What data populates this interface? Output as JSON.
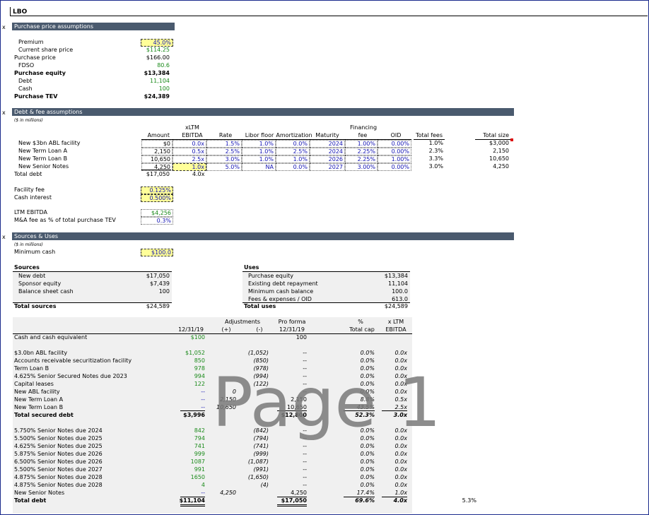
{
  "title": "LBO",
  "x_marker": "x",
  "sections": {
    "purchase": "Purchase price assumptions",
    "debt": "Debt & fee assumptions",
    "sources_uses": "Sources & Uses"
  },
  "units_note": "($ in millions)",
  "purchase": {
    "rows": [
      {
        "label": "Premium",
        "value": "45.0%"
      },
      {
        "label": "Current share price",
        "value": "$114.25"
      },
      {
        "label": "Purchase price",
        "value": "$166.00"
      },
      {
        "label": "FDSO",
        "value": "80.6"
      },
      {
        "label": "Purchase equity",
        "value": "$13,384"
      },
      {
        "label": "Debt",
        "value": "11,104"
      },
      {
        "label": "Cash",
        "value": "100"
      },
      {
        "label": "Purchase TEV",
        "value": "$24,389"
      }
    ]
  },
  "debt": {
    "headers": {
      "amount": "Amount",
      "xltm_top": "xLTM",
      "ebitda": "EBITDA",
      "rate": "Rate",
      "libor": "Libor floor",
      "amort": "Amortization",
      "maturity": "Maturity",
      "fin_top": "Financing",
      "fee": "fee",
      "oid": "OID",
      "total_fees": "Total fees",
      "total_size": "Total size"
    },
    "rows": [
      {
        "label": "New $3bn ABL facility",
        "amount": "$0",
        "ebitda": "0.0x",
        "rate": "1.5%",
        "libor": "1.0%",
        "amort": "0.0%",
        "maturity": "2024",
        "fee": "1.00%",
        "oid": "0.00%",
        "total_fees": "1.0%",
        "total_size": "$3,000"
      },
      {
        "label": "New Term Loan A",
        "amount": "2,150",
        "ebitda": "0.5x",
        "rate": "2.5%",
        "libor": "1.0%",
        "amort": "2.5%",
        "maturity": "2024",
        "fee": "2.25%",
        "oid": "0.00%",
        "total_fees": "2.3%",
        "total_size": "2,150"
      },
      {
        "label": "New Term Loan B",
        "amount": "10,650",
        "ebitda": "2.5x",
        "rate": "3.0%",
        "libor": "1.0%",
        "amort": "1.0%",
        "maturity": "2026",
        "fee": "2.25%",
        "oid": "1.00%",
        "total_fees": "3.3%",
        "total_size": "10,650"
      },
      {
        "label": "New Senior Notes",
        "amount": "4,250",
        "ebitda": "1.0x",
        "rate": "5.0%",
        "libor": "NA",
        "amort": "0.0%",
        "maturity": "2027",
        "fee": "3.00%",
        "oid": "0.00%",
        "total_fees": "3.0%",
        "total_size": "4,250"
      }
    ],
    "total": {
      "label": "Total debt",
      "amount": "$17,050",
      "ebitda": "4.0x"
    },
    "facility_fee_label": "Facility fee",
    "facility_fee": "0.125%",
    "cash_interest_label": "Cash interest",
    "cash_interest": "0.500%",
    "ltm_ebitda_label": "LTM EBITDA",
    "ltm_ebitda": "$4,256",
    "ma_fee_label": "M&A fee as % of total purchase TEV",
    "ma_fee": "0.3%"
  },
  "su": {
    "min_cash_label": "Minimum cash",
    "min_cash": "$100.0",
    "sources_title": "Sources",
    "sources": [
      {
        "label": "New debt",
        "value": "$17,050"
      },
      {
        "label": "Sponsor equity",
        "value": "$7,439"
      },
      {
        "label": "Balance sheet cash",
        "value": "100"
      }
    ],
    "total_sources_label": "Total sources",
    "total_sources": "$24,589",
    "uses_title": "Uses",
    "uses": [
      {
        "label": "Purchase equity",
        "value": "$13,384"
      },
      {
        "label": "Existing debt repayment",
        "value": "11,104"
      },
      {
        "label": "Minimum cash balance",
        "value": "100.0"
      },
      {
        "label": "Fees & expenses / OID",
        "value": "613.0"
      }
    ],
    "total_uses_label": "Total uses",
    "total_uses": "$24,589"
  },
  "cap": {
    "headers": {
      "date": "12/31/19",
      "adj": "Adjustments",
      "plus": "(+)",
      "minus": "(-)",
      "pf_top": "Pro forma",
      "pf_date": "12/31/19",
      "pct_top": "%",
      "pct": "Total cap",
      "xltm_top": "x LTM",
      "xltm": "EBITDA"
    },
    "cash_row": {
      "label": "Cash and cash equivalent",
      "cur": "$100",
      "pf": "100"
    },
    "secured": [
      {
        "label": "$3.0bn ABL facility",
        "cur": "$1,052",
        "plus": "",
        "minus": "(1,052)",
        "pf": "--",
        "pct": "0.0%",
        "x": "0.0x"
      },
      {
        "label": "Accounts receivable securitization facility",
        "cur": "850",
        "plus": "",
        "minus": "(850)",
        "pf": "--",
        "pct": "0.0%",
        "x": "0.0x"
      },
      {
        "label": "Term Loan B",
        "cur": "978",
        "plus": "",
        "minus": "(978)",
        "pf": "--",
        "pct": "0.0%",
        "x": "0.0x"
      },
      {
        "label": "4.625% Senior Secured Notes due 2023",
        "cur": "994",
        "plus": "",
        "minus": "(994)",
        "pf": "--",
        "pct": "0.0%",
        "x": "0.0x"
      },
      {
        "label": "Capital leases",
        "cur": "122",
        "plus": "",
        "minus": "(122)",
        "pf": "--",
        "pct": "0.0%",
        "x": "0.0x"
      },
      {
        "label": "New ABL facility",
        "cur": "--",
        "plus": "0",
        "minus": "",
        "pf": "--",
        "pct": "0.0%",
        "x": "0.0x"
      },
      {
        "label": "New Term Loan A",
        "cur": "--",
        "plus": "2,150",
        "minus": "",
        "pf": "2,150",
        "pct": "8.8%",
        "x": "0.5x"
      },
      {
        "label": "New Term Loan B",
        "cur": "--",
        "plus": "10,650",
        "minus": "",
        "pf": "10,650",
        "pct": "43.5%",
        "x": "2.5x"
      }
    ],
    "total_secured": {
      "label": "Total secured debt",
      "cur": "$3,996",
      "pf": "$12,800",
      "pct": "52.3%",
      "x": "3.0x"
    },
    "unsecured": [
      {
        "label": "5.750% Senior Notes due 2024",
        "cur": "842",
        "plus": "",
        "minus": "(842)",
        "pf": "--",
        "pct": "0.0%",
        "x": "0.0x"
      },
      {
        "label": "5.500% Senior Notes due 2025",
        "cur": "794",
        "plus": "",
        "minus": "(794)",
        "pf": "--",
        "pct": "0.0%",
        "x": "0.0x"
      },
      {
        "label": "4.625% Senior Notes due 2025",
        "cur": "741",
        "plus": "",
        "minus": "(741)",
        "pf": "--",
        "pct": "0.0%",
        "x": "0.0x"
      },
      {
        "label": "5.875% Senior Notes due 2026",
        "cur": "999",
        "plus": "",
        "minus": "(999)",
        "pf": "--",
        "pct": "0.0%",
        "x": "0.0x"
      },
      {
        "label": "6.500% Senior Notes due 2026",
        "cur": "1087",
        "plus": "",
        "minus": "(1,087)",
        "pf": "--",
        "pct": "0.0%",
        "x": "0.0x"
      },
      {
        "label": "5.500% Senior Notes due 2027",
        "cur": "991",
        "plus": "",
        "minus": "(991)",
        "pf": "--",
        "pct": "0.0%",
        "x": "0.0x"
      },
      {
        "label": "4.875% Senior Notes due 2028",
        "cur": "1650",
        "plus": "",
        "minus": "(1,650)",
        "pf": "--",
        "pct": "0.0%",
        "x": "0.0x"
      },
      {
        "label": "4.875% Senior Notes due 2028",
        "cur": "4",
        "plus": "",
        "minus": "(4)",
        "pf": "--",
        "pct": "0.0%",
        "x": "0.0x"
      },
      {
        "label": "New Senior Notes",
        "cur": "--",
        "plus": "4,250",
        "minus": "",
        "pf": "4,250",
        "pct": "17.4%",
        "x": "1.0x"
      }
    ],
    "total_debt": {
      "label": "Total debt",
      "cur": "$11,104",
      "pf": "$17,050",
      "pct": "69.6%",
      "x": "4.0x"
    },
    "side_value": "5.3%"
  },
  "watermark": "Page 1"
}
